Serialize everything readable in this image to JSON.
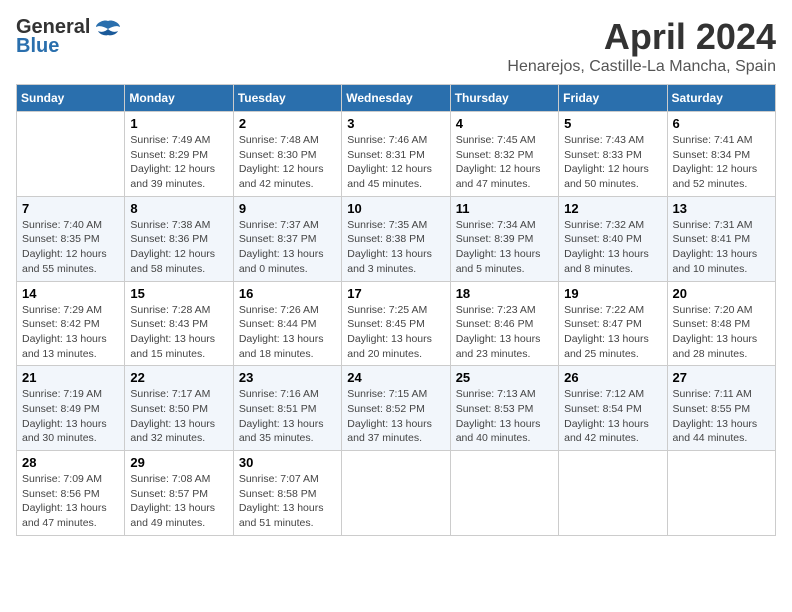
{
  "header": {
    "logo_general": "General",
    "logo_blue": "Blue",
    "month_title": "April 2024",
    "location": "Henarejos, Castille-La Mancha, Spain"
  },
  "weekdays": [
    "Sunday",
    "Monday",
    "Tuesday",
    "Wednesday",
    "Thursday",
    "Friday",
    "Saturday"
  ],
  "weeks": [
    [
      {
        "day": "",
        "sunrise": "",
        "sunset": "",
        "daylight": ""
      },
      {
        "day": "1",
        "sunrise": "Sunrise: 7:49 AM",
        "sunset": "Sunset: 8:29 PM",
        "daylight": "Daylight: 12 hours and 39 minutes."
      },
      {
        "day": "2",
        "sunrise": "Sunrise: 7:48 AM",
        "sunset": "Sunset: 8:30 PM",
        "daylight": "Daylight: 12 hours and 42 minutes."
      },
      {
        "day": "3",
        "sunrise": "Sunrise: 7:46 AM",
        "sunset": "Sunset: 8:31 PM",
        "daylight": "Daylight: 12 hours and 45 minutes."
      },
      {
        "day": "4",
        "sunrise": "Sunrise: 7:45 AM",
        "sunset": "Sunset: 8:32 PM",
        "daylight": "Daylight: 12 hours and 47 minutes."
      },
      {
        "day": "5",
        "sunrise": "Sunrise: 7:43 AM",
        "sunset": "Sunset: 8:33 PM",
        "daylight": "Daylight: 12 hours and 50 minutes."
      },
      {
        "day": "6",
        "sunrise": "Sunrise: 7:41 AM",
        "sunset": "Sunset: 8:34 PM",
        "daylight": "Daylight: 12 hours and 52 minutes."
      }
    ],
    [
      {
        "day": "7",
        "sunrise": "Sunrise: 7:40 AM",
        "sunset": "Sunset: 8:35 PM",
        "daylight": "Daylight: 12 hours and 55 minutes."
      },
      {
        "day": "8",
        "sunrise": "Sunrise: 7:38 AM",
        "sunset": "Sunset: 8:36 PM",
        "daylight": "Daylight: 12 hours and 58 minutes."
      },
      {
        "day": "9",
        "sunrise": "Sunrise: 7:37 AM",
        "sunset": "Sunset: 8:37 PM",
        "daylight": "Daylight: 13 hours and 0 minutes."
      },
      {
        "day": "10",
        "sunrise": "Sunrise: 7:35 AM",
        "sunset": "Sunset: 8:38 PM",
        "daylight": "Daylight: 13 hours and 3 minutes."
      },
      {
        "day": "11",
        "sunrise": "Sunrise: 7:34 AM",
        "sunset": "Sunset: 8:39 PM",
        "daylight": "Daylight: 13 hours and 5 minutes."
      },
      {
        "day": "12",
        "sunrise": "Sunrise: 7:32 AM",
        "sunset": "Sunset: 8:40 PM",
        "daylight": "Daylight: 13 hours and 8 minutes."
      },
      {
        "day": "13",
        "sunrise": "Sunrise: 7:31 AM",
        "sunset": "Sunset: 8:41 PM",
        "daylight": "Daylight: 13 hours and 10 minutes."
      }
    ],
    [
      {
        "day": "14",
        "sunrise": "Sunrise: 7:29 AM",
        "sunset": "Sunset: 8:42 PM",
        "daylight": "Daylight: 13 hours and 13 minutes."
      },
      {
        "day": "15",
        "sunrise": "Sunrise: 7:28 AM",
        "sunset": "Sunset: 8:43 PM",
        "daylight": "Daylight: 13 hours and 15 minutes."
      },
      {
        "day": "16",
        "sunrise": "Sunrise: 7:26 AM",
        "sunset": "Sunset: 8:44 PM",
        "daylight": "Daylight: 13 hours and 18 minutes."
      },
      {
        "day": "17",
        "sunrise": "Sunrise: 7:25 AM",
        "sunset": "Sunset: 8:45 PM",
        "daylight": "Daylight: 13 hours and 20 minutes."
      },
      {
        "day": "18",
        "sunrise": "Sunrise: 7:23 AM",
        "sunset": "Sunset: 8:46 PM",
        "daylight": "Daylight: 13 hours and 23 minutes."
      },
      {
        "day": "19",
        "sunrise": "Sunrise: 7:22 AM",
        "sunset": "Sunset: 8:47 PM",
        "daylight": "Daylight: 13 hours and 25 minutes."
      },
      {
        "day": "20",
        "sunrise": "Sunrise: 7:20 AM",
        "sunset": "Sunset: 8:48 PM",
        "daylight": "Daylight: 13 hours and 28 minutes."
      }
    ],
    [
      {
        "day": "21",
        "sunrise": "Sunrise: 7:19 AM",
        "sunset": "Sunset: 8:49 PM",
        "daylight": "Daylight: 13 hours and 30 minutes."
      },
      {
        "day": "22",
        "sunrise": "Sunrise: 7:17 AM",
        "sunset": "Sunset: 8:50 PM",
        "daylight": "Daylight: 13 hours and 32 minutes."
      },
      {
        "day": "23",
        "sunrise": "Sunrise: 7:16 AM",
        "sunset": "Sunset: 8:51 PM",
        "daylight": "Daylight: 13 hours and 35 minutes."
      },
      {
        "day": "24",
        "sunrise": "Sunrise: 7:15 AM",
        "sunset": "Sunset: 8:52 PM",
        "daylight": "Daylight: 13 hours and 37 minutes."
      },
      {
        "day": "25",
        "sunrise": "Sunrise: 7:13 AM",
        "sunset": "Sunset: 8:53 PM",
        "daylight": "Daylight: 13 hours and 40 minutes."
      },
      {
        "day": "26",
        "sunrise": "Sunrise: 7:12 AM",
        "sunset": "Sunset: 8:54 PM",
        "daylight": "Daylight: 13 hours and 42 minutes."
      },
      {
        "day": "27",
        "sunrise": "Sunrise: 7:11 AM",
        "sunset": "Sunset: 8:55 PM",
        "daylight": "Daylight: 13 hours and 44 minutes."
      }
    ],
    [
      {
        "day": "28",
        "sunrise": "Sunrise: 7:09 AM",
        "sunset": "Sunset: 8:56 PM",
        "daylight": "Daylight: 13 hours and 47 minutes."
      },
      {
        "day": "29",
        "sunrise": "Sunrise: 7:08 AM",
        "sunset": "Sunset: 8:57 PM",
        "daylight": "Daylight: 13 hours and 49 minutes."
      },
      {
        "day": "30",
        "sunrise": "Sunrise: 7:07 AM",
        "sunset": "Sunset: 8:58 PM",
        "daylight": "Daylight: 13 hours and 51 minutes."
      },
      {
        "day": "",
        "sunrise": "",
        "sunset": "",
        "daylight": ""
      },
      {
        "day": "",
        "sunrise": "",
        "sunset": "",
        "daylight": ""
      },
      {
        "day": "",
        "sunrise": "",
        "sunset": "",
        "daylight": ""
      },
      {
        "day": "",
        "sunrise": "",
        "sunset": "",
        "daylight": ""
      }
    ]
  ]
}
